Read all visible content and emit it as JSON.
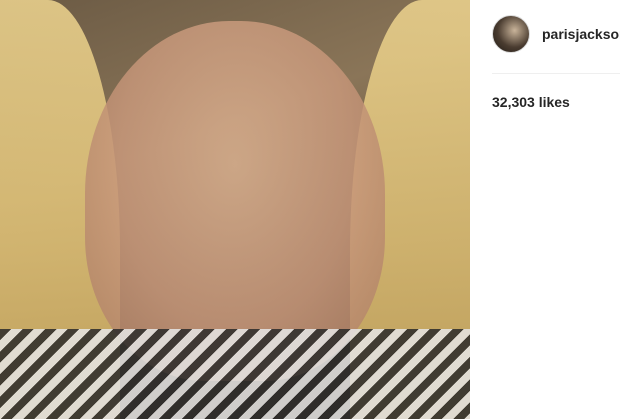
{
  "post": {
    "username": "parisjacksor",
    "likes": "32,303 likes"
  }
}
